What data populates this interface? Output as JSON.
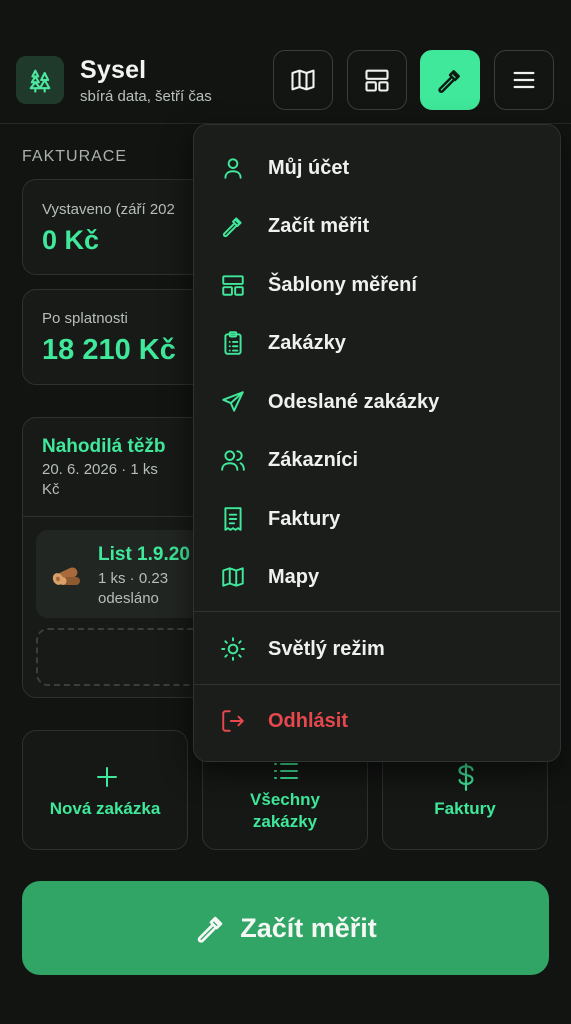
{
  "app": {
    "name": "Sysel",
    "tagline": "sbírá data, šetří čas"
  },
  "colors": {
    "accent": "#3fe89a",
    "primary": "#30a566",
    "danger": "#e5484d",
    "background": "#121412"
  },
  "header": {
    "buttons": [
      {
        "icon": "map-icon",
        "active": false
      },
      {
        "icon": "layout-template-icon",
        "active": false
      },
      {
        "icon": "hammer-icon",
        "active": true
      },
      {
        "icon": "menu-icon",
        "active": false
      }
    ]
  },
  "invoicing": {
    "section_title": "FAKTURACE",
    "issued": {
      "label": "Vystaveno (září 202",
      "value": "0 Kč"
    },
    "overdue": {
      "label": "Po splatnosti",
      "value": "18 210 Kč"
    }
  },
  "job": {
    "title": "Nahodilá těžb",
    "subtitle_line1": "20. 6. 2026 · 1 ks",
    "subtitle_line2": "Kč",
    "item": {
      "title": "List 1.9.20",
      "meta": "1 ks · 0.23",
      "status": "odesláno",
      "icon": "wood-log-icon"
    }
  },
  "actions": [
    {
      "icon": "plus-icon",
      "label": "Nová zakázka"
    },
    {
      "icon": "list-icon",
      "label_line1": "Všechny",
      "label_line2": "zakázky"
    },
    {
      "icon": "dollar-icon",
      "label": "Faktury"
    }
  ],
  "cta": {
    "label": "Začít měřit",
    "icon": "hammer-icon"
  },
  "menu": {
    "items": [
      {
        "icon": "user-icon",
        "label": "Můj účet"
      },
      {
        "icon": "hammer-icon",
        "label": "Začít měřit"
      },
      {
        "icon": "layout-template-icon",
        "label": "Šablony měření"
      },
      {
        "icon": "clipboard-list-icon",
        "label": "Zakázky"
      },
      {
        "icon": "send-icon",
        "label": "Odeslané zakázky"
      },
      {
        "icon": "users-icon",
        "label": "Zákazníci"
      },
      {
        "icon": "receipt-icon",
        "label": "Faktury"
      },
      {
        "icon": "map-icon",
        "label": "Mapy"
      }
    ],
    "theme": {
      "icon": "sun-icon",
      "label": "Světlý režim"
    },
    "logout": {
      "icon": "logout-icon",
      "label": "Odhlásit"
    }
  }
}
